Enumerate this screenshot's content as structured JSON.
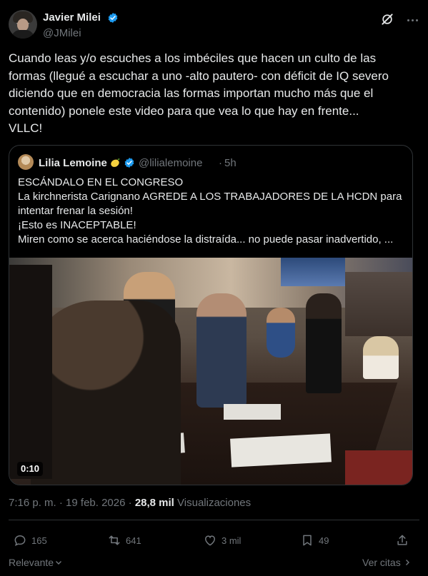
{
  "author": {
    "name": "Javier Milei",
    "handle": "@JMilei"
  },
  "tweet": {
    "lines": [
      "Cuando leas y/o escuches a los imbéciles que hacen un culto de las",
      "formas (llegué a escuchar a uno -alto pautero- con déficit de IQ severo",
      "diciendo que en democracia las formas importan mucho más que el",
      "contenido) ponele este video para que vea lo que hay en frente...",
      "VLLC!"
    ]
  },
  "quote": {
    "name": "Lilia Lemoine",
    "handle": "@lilialemoine",
    "dot": "·",
    "time": "5h",
    "lines": [
      "ESCÁNDALO EN EL CONGRESO",
      "La kirchnerista Carignano AGREDE A LOS TRABAJADORES DE LA HCDN para",
      "intentar frenar la sesión!",
      "¡Esto es INACEPTABLE!",
      "Miren como se acerca haciéndose la distraída... no puede pasar inadvertido, ..."
    ],
    "video_duration": "0:10"
  },
  "meta": {
    "time": "7:16 p. m.",
    "separator": "·",
    "date": "19 feb. 2026",
    "views_count": "28,8 mil",
    "views_label": "Visualizaciones"
  },
  "actions": {
    "replies": "165",
    "reposts": "641",
    "likes": "3 mil",
    "bookmarks": "49"
  },
  "footer": {
    "sort_label": "Relevante",
    "quotes_link": "Ver citas"
  },
  "icons": [
    "verified-badge-icon",
    "grok-icon",
    "more-options-icon",
    "lemon-emoji-icon",
    "reply-icon",
    "repost-icon",
    "like-icon",
    "bookmark-icon",
    "share-icon",
    "chevron-down-icon",
    "chevron-right-icon"
  ],
  "colors": {
    "background": "#000000",
    "text": "#e7e9ea",
    "secondary": "#71767b",
    "verified": "#1d9bf0",
    "border": "#2f3336"
  }
}
